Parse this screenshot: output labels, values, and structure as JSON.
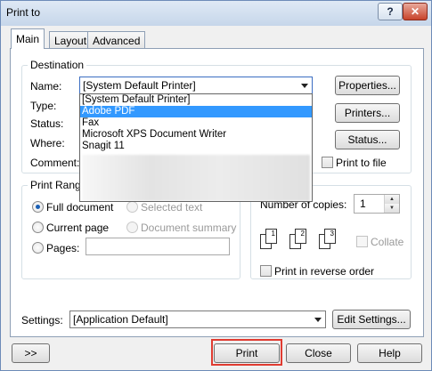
{
  "window": {
    "title": "Print to",
    "help_glyph": "?",
    "close_glyph": "✕"
  },
  "tabs": [
    {
      "label": "Main",
      "active": true
    },
    {
      "label": "Layout",
      "active": false
    },
    {
      "label": "Advanced",
      "active": false
    }
  ],
  "destination": {
    "legend": "Destination",
    "name_label": "Name:",
    "name_value": "[System Default Printer]",
    "type_label": "Type:",
    "status_label": "Status:",
    "where_label": "Where:",
    "comment_label": "Comment:",
    "properties_button": "Properties...",
    "printers_button": "Printers...",
    "status_button": "Status...",
    "print_to_file_label": "Print to file",
    "print_to_file_checked": false,
    "dropdown_options": [
      {
        "label": "[System Default Printer]",
        "selected": false
      },
      {
        "label": "Adobe PDF",
        "selected": true
      },
      {
        "label": "Fax",
        "selected": false
      },
      {
        "label": "Microsoft XPS Document Writer",
        "selected": false
      },
      {
        "label": "Snagit 11",
        "selected": false
      }
    ]
  },
  "print_range": {
    "legend": "Print Range",
    "full_document": "Full document",
    "selected_text": "Selected text",
    "current_page": "Current page",
    "document_summary": "Document summary",
    "pages": "Pages:",
    "pages_value": "",
    "selected": "full_document"
  },
  "copies": {
    "label": "Number of copies:",
    "value": "1",
    "collate_label": "Collate",
    "collate_checked": false,
    "reverse_label": "Print in reverse order",
    "reverse_checked": false,
    "page_numbers": [
      "1",
      "1",
      "2",
      "2",
      "3",
      "3"
    ]
  },
  "settings": {
    "label": "Settings:",
    "value": "[Application Default]",
    "edit_button": "Edit Settings..."
  },
  "footer": {
    "expand_button": ">>",
    "print_button": "Print",
    "close_button": "Close",
    "help_button": "Help"
  },
  "colors": {
    "selection": "#3399ff",
    "highlight_box": "#e03c31"
  }
}
